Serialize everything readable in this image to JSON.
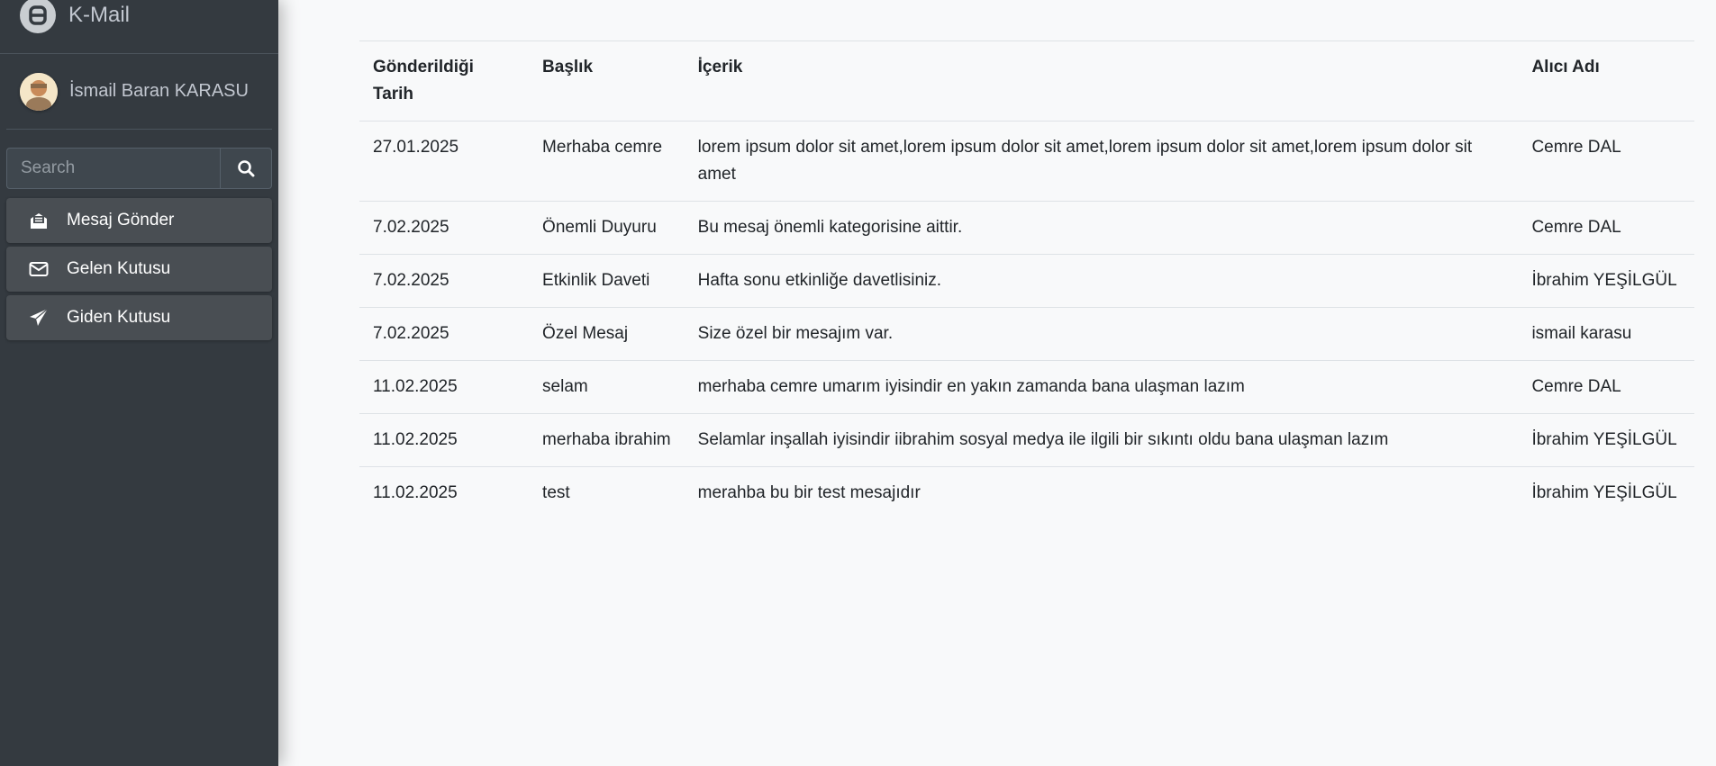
{
  "app": {
    "title": "K-Mail"
  },
  "user": {
    "name": "İsmail Baran KARASU"
  },
  "search": {
    "placeholder": "Search"
  },
  "nav": [
    {
      "label": "Mesaj Gönder",
      "icon": "envelope-open-icon"
    },
    {
      "label": "Gelen Kutusu",
      "icon": "envelope-icon"
    },
    {
      "label": "Giden Kutusu",
      "icon": "paper-plane-icon"
    }
  ],
  "table": {
    "headers": [
      "Gönderildiği Tarih",
      "Başlık",
      "İçerik",
      "Alıcı Adı"
    ],
    "rows": [
      [
        "27.01.2025",
        "Merhaba cemre",
        "lorem ipsum dolor sit amet,lorem ipsum dolor sit amet,lorem ipsum dolor sit amet,lorem ipsum dolor sit amet",
        "Cemre DAL"
      ],
      [
        "7.02.2025",
        "Önemli Duyuru",
        "Bu mesaj önemli kategorisine aittir.",
        "Cemre DAL"
      ],
      [
        "7.02.2025",
        "Etkinlik Daveti",
        "Hafta sonu etkinliğe davetlisiniz.",
        "İbrahim YEŞİLGÜL"
      ],
      [
        "7.02.2025",
        "Özel Mesaj",
        "Size özel bir mesajım var.",
        "ismail karasu"
      ],
      [
        "11.02.2025",
        "selam",
        "merhaba cemre umarım iyisindir en yakın zamanda bana ulaşman lazım",
        "Cemre DAL"
      ],
      [
        "11.02.2025",
        "merhaba ibrahim",
        "Selamlar inşallah iyisindir iibrahim sosyal medya ile ilgili bir sıkıntı oldu bana ulaşman lazım",
        "İbrahim YEŞİLGÜL"
      ],
      [
        "11.02.2025",
        "test",
        "merahba bu bir test mesajıdır",
        "İbrahim YEŞİLGÜL"
      ]
    ]
  }
}
